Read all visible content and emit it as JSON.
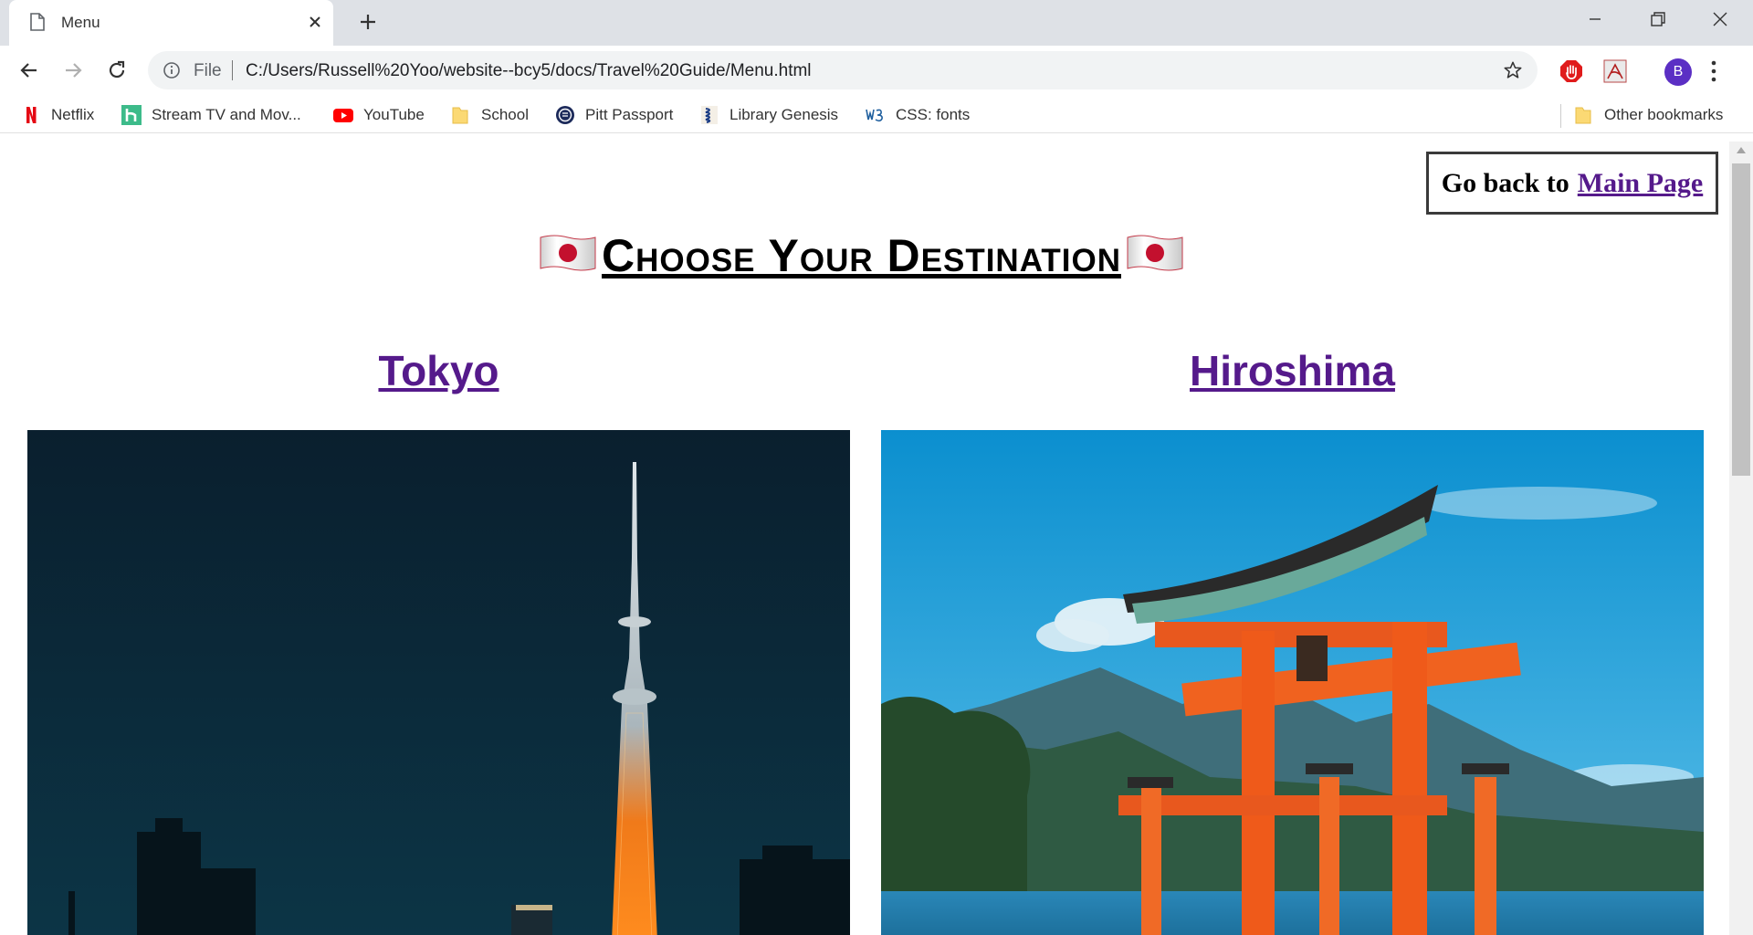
{
  "tab": {
    "title": "Menu",
    "icon": "document-icon"
  },
  "toolbar": {
    "scheme": "File",
    "url": "C:/Users/Russell%20Yoo/website--bcy5/docs/Travel%20Guide/Menu.html",
    "profile_initial": "B"
  },
  "bookmarks": [
    {
      "label": "Netflix",
      "icon": "netflix-icon"
    },
    {
      "label": "Stream TV and Mov...",
      "icon": "hulu-icon"
    },
    {
      "label": "YouTube",
      "icon": "youtube-icon"
    },
    {
      "label": "School",
      "icon": "folder-icon"
    },
    {
      "label": "Pitt Passport",
      "icon": "pitt-icon"
    },
    {
      "label": "Library Genesis",
      "icon": "library-icon"
    },
    {
      "label": "CSS: fonts",
      "icon": "w3schools-icon"
    }
  ],
  "other_bookmarks": "Other bookmarks",
  "page": {
    "back_prefix": "Go back to",
    "back_link": "Main Page",
    "heading": "Choose Your Destination",
    "flag": "japan-flag",
    "destinations": [
      {
        "name": "Tokyo",
        "image": "tokyo-skytree-night"
      },
      {
        "name": "Hiroshima",
        "image": "itsukushima-torii-gate"
      }
    ]
  },
  "colors": {
    "link_visited": "#551a8b",
    "tab_strip": "#dee1e6",
    "omnibox": "#f1f3f4",
    "avatar": "#5b2fc4"
  }
}
